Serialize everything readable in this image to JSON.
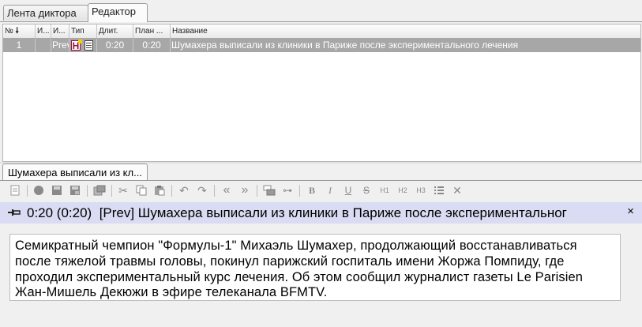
{
  "tabs": [
    {
      "label": "Лента диктора"
    },
    {
      "label": "Редактор"
    }
  ],
  "grid": {
    "columns": [
      "№",
      "И...",
      "И...",
      "Тип",
      "Длит.",
      "План ...",
      "Название"
    ],
    "rows": [
      {
        "num": "1",
        "id": "",
        "source": "Prev",
        "type_icon": "H",
        "type_doc_icon": "document-icon",
        "duration": "0:20",
        "plan": "0:20",
        "title": "Шумахера выписали из клиники в Париже после экспериментального лечения"
      }
    ]
  },
  "doc_tab": {
    "label": "Шумахера выписали из кл..."
  },
  "toolbar": {
    "icons": [
      "new-doc-icon",
      "record-icon",
      "save-icon",
      "save-as-icon",
      "insert-icon",
      "cut-icon",
      "copy-icon",
      "paste-icon",
      "undo-icon",
      "redo-icon",
      "prev-icon",
      "next-icon",
      "timing-icon",
      "pin-icon",
      "bold-icon",
      "italic-icon",
      "underline-icon",
      "strike-icon",
      "h1-icon",
      "h2-icon",
      "h3-icon",
      "list-icon",
      "clear-format-icon"
    ],
    "labels": {
      "bold": "B",
      "italic": "I",
      "underline": "U",
      "strike": "S",
      "h1": "H1",
      "h2": "H2",
      "h3": "H3"
    }
  },
  "story_header": {
    "duration": "0:20 (0:20)",
    "text": "[Prev] Шумахера выписали из клиники в Париже после экспериментальног"
  },
  "editor": {
    "text": "Семикратный чемпион \"Формулы-1\" Михаэль Шумахер, продолжающий восстанавливаться после тяжелой травмы головы, покинул парижский госпиталь имени Жоржа Помпиду, где проходил экспериментальный курс лечения. Об этом сообщил журналист газеты Le Parisien Жан-Мишель Декюжи в эфире телеканала BFMTV."
  },
  "colors": {
    "row_selected": "#a7a7a7",
    "header_bar": "#d9dcf2",
    "type_icon": "#9b0d3d"
  }
}
